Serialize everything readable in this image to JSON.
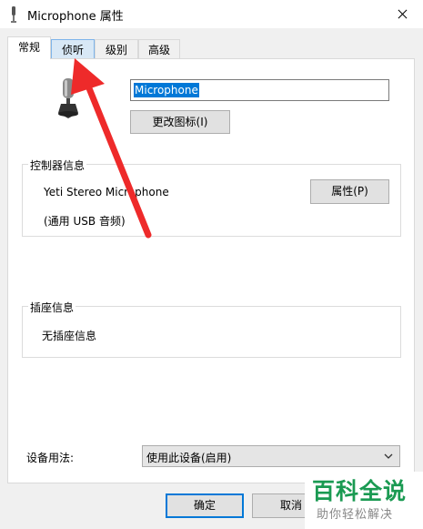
{
  "window": {
    "title": "Microphone 属性",
    "close_icon": "close-icon"
  },
  "tabs": [
    {
      "label": "常规",
      "active": true
    },
    {
      "label": "侦听",
      "active": false
    },
    {
      "label": "级别",
      "active": false
    },
    {
      "label": "高级",
      "active": false
    }
  ],
  "general": {
    "device_icon": "microphone-icon",
    "name_value": "Microphone",
    "change_icon_label": "更改图标(I)",
    "controller": {
      "heading": "控制器信息",
      "device_name": "Yeti Stereo Microphone",
      "bus": "(通用 USB 音频)",
      "properties_label": "属性(P)"
    },
    "jack": {
      "heading": "插座信息",
      "text": "无插座信息"
    },
    "usage": {
      "label": "设备用法:",
      "selected": "使用此设备(启用)"
    }
  },
  "footer": {
    "ok_label": "确定",
    "cancel_label": "取消"
  },
  "annotation": {
    "color": "#ee2a2a"
  },
  "watermark": {
    "line1": "百科全说",
    "line2": "助你轻松解决"
  }
}
